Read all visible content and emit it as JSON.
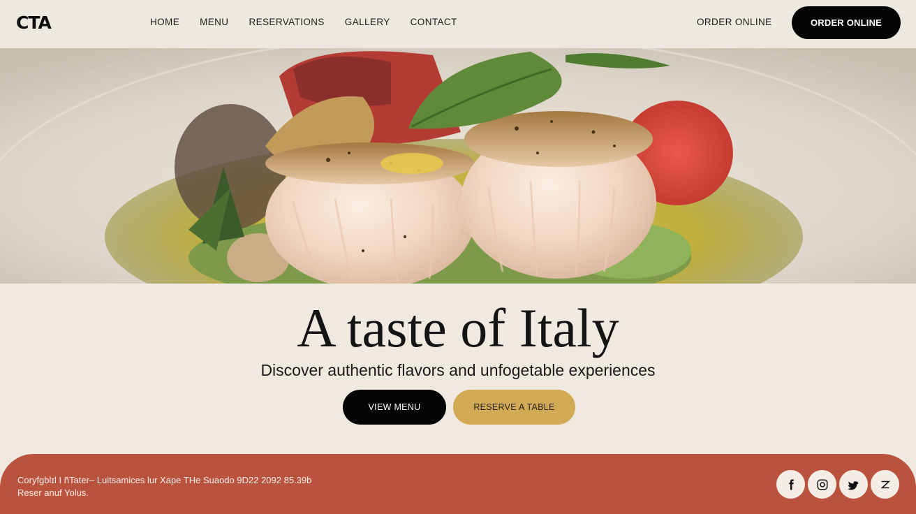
{
  "header": {
    "logo": "CTA",
    "nav": [
      "HOME",
      "MENU",
      "RESERVATIONS",
      "GALLERY",
      "CONTACT"
    ],
    "order_link": "ORDER ONLINE",
    "order_button": "ORDER ONLINE"
  },
  "hero": {
    "image": "seared-scallops-dish-photo",
    "headline": "A taste of Italy",
    "subheadline": "Discover authentic flavors and unfogetable experiences",
    "primary_button": "VIEW MENU",
    "secondary_button": "RESERVE A TABLE"
  },
  "footer": {
    "copyright_line1": "Coryfgblɪl I ñTater– Luitsamices lur Xape THe Suaodo 9D22 2092 85.39b",
    "copyright_line2": "Reser anuf Yolus.",
    "social_icons": [
      "facebook-icon",
      "instagram-icon",
      "twitter-icon",
      "z-icon"
    ]
  },
  "colors": {
    "page_bg": "#efe9df",
    "primary_button": "#050505",
    "accent_gold": "#d2aa55",
    "footer_bg": "#b9533e"
  }
}
